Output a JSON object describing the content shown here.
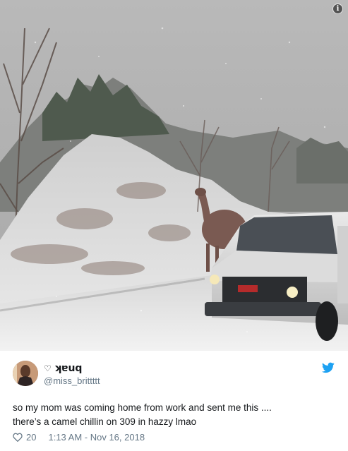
{
  "media": {
    "description_icon": "info-icon",
    "info_glyph": "i"
  },
  "author": {
    "display_name": "ʞɐuq",
    "name_prefix_icon": "heart-icon",
    "handle": "@miss_brittttt",
    "avatar_icon": "avatar"
  },
  "brand": {
    "icon": "twitter-bird-icon",
    "color": "#1da1f2"
  },
  "tweet": {
    "text_lines": [
      "so my mom was coming home from work and sent me this ....",
      "there’s a camel chillin on 309 in hazzy lmao"
    ]
  },
  "footer": {
    "like_icon": "heart-outline-icon",
    "like_count": "20",
    "timestamp": "1:13 AM - Nov 16, 2018"
  },
  "colors": {
    "text_primary": "#14171a",
    "text_secondary": "#657786",
    "accent": "#1da1f2"
  }
}
